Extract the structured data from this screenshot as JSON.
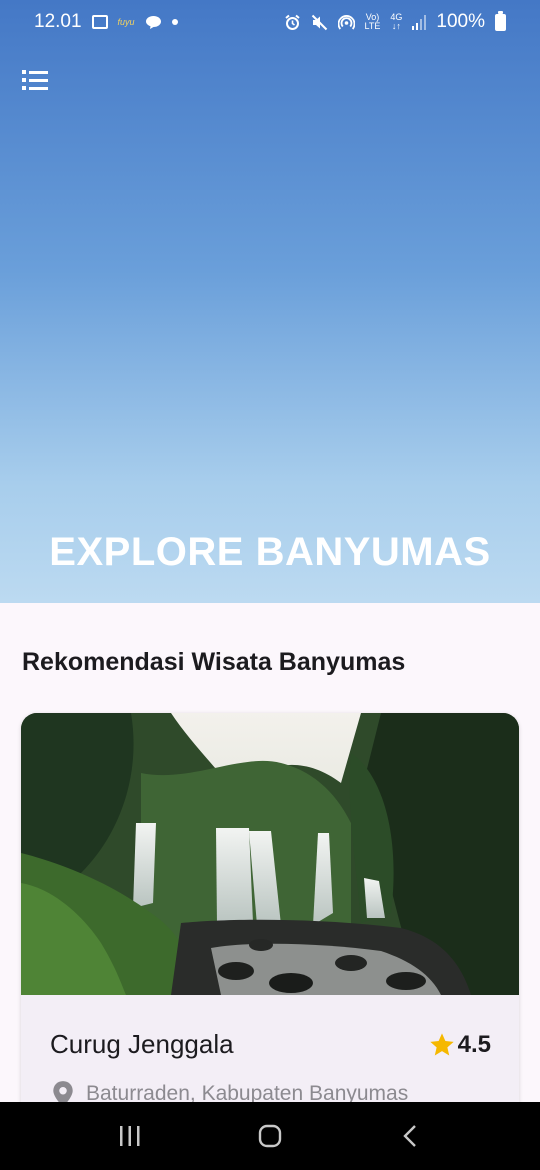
{
  "status_bar": {
    "time": "12.01",
    "battery": "100%",
    "network_top": "Vo)",
    "network_bottom": "LTE",
    "signal_top": "4G",
    "badge": "fuyu"
  },
  "hero": {
    "title": "EXPLORE BANYUMAS"
  },
  "section": {
    "title": "Rekomendasi Wisata Banyumas"
  },
  "cards": [
    {
      "title": "Curug Jenggala",
      "rating": "4.5",
      "location": "Baturraden, Kabupaten Banyumas",
      "image": "waterfall-photo"
    }
  ],
  "colors": {
    "hero_top": "#4478c6",
    "hero_bottom": "#bcdaf1",
    "background": "#fcf7fc",
    "card": "#f3eef6",
    "star": "#f5b800"
  },
  "icons": {
    "menu": "menu-list-icon",
    "star": "star-icon",
    "location": "location-pin-icon",
    "nav_recents": "recents-icon",
    "nav_home": "home-icon",
    "nav_back": "back-icon"
  }
}
